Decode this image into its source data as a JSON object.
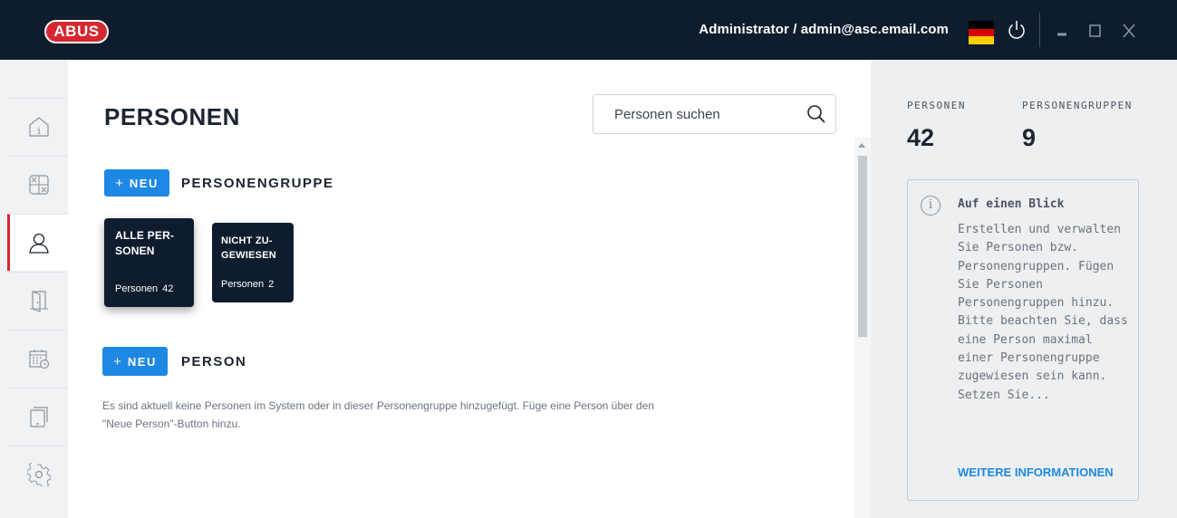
{
  "header": {
    "logo": "ABUS",
    "user": "Administrator / admin@asc.email.com",
    "language_icon": "german-flag-icon",
    "power_icon": "power-icon",
    "window_controls": [
      "minimize-icon",
      "maximize-icon",
      "close-icon"
    ]
  },
  "sidebar": {
    "items": [
      {
        "icon": "info-icon",
        "active": false
      },
      {
        "icon": "access-matrix-icon",
        "active": false
      },
      {
        "icon": "person-icon",
        "active": true
      },
      {
        "icon": "door-icon",
        "active": false
      },
      {
        "icon": "calendar-icon",
        "active": false
      },
      {
        "icon": "device-icon",
        "active": false
      },
      {
        "icon": "gear-icon",
        "active": false
      }
    ],
    "active_color": "#d6262f"
  },
  "main": {
    "title": "PERSONEN",
    "search": {
      "placeholder": "Personen suchen",
      "value": ""
    },
    "groups_section": {
      "new_label": "NEU",
      "label": "PERSONENGRUPPE",
      "groups": [
        {
          "name": "ALLE PER-\nSONEN",
          "count_label": "Personen",
          "count": "42"
        },
        {
          "name": "NICHT ZU-\nGEWIESEN",
          "count_label": "Personen",
          "count": "2"
        }
      ]
    },
    "persons_section": {
      "new_label": "NEU",
      "label": "PERSON",
      "empty_message": "Es sind aktuell keine Personen im System oder in dieser Personengruppe hinzugefügt. Füge eine Person über den \"Neue Person\"-Button hinzu."
    }
  },
  "right_panel": {
    "stats": [
      {
        "label": "PERSONEN",
        "value": "42"
      },
      {
        "label": "PERSONENGRUPPEN",
        "value": "9"
      }
    ],
    "info": {
      "title": "Auf einen Blick",
      "text": "Erstellen und verwalten Sie Personen bzw. Personengruppen. Fügen Sie Personen Personengruppen hinzu. Bitte beachten Sie, dass eine Person maximal einer Personengruppe zugewiesen sein kann. Setzen Sie...",
      "link": "WEITERE INFORMATIONEN"
    }
  },
  "colors": {
    "header_bg": "#0e1c2e",
    "accent_blue": "#1e88e5",
    "brand_red": "#d6262f",
    "card_bg": "#0e1c2e"
  }
}
